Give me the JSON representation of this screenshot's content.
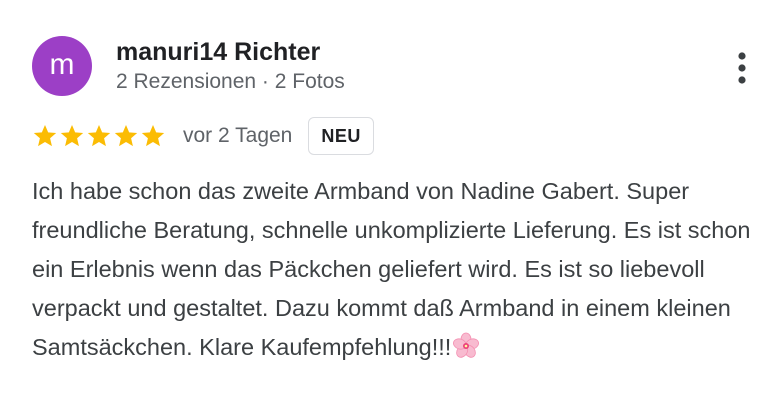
{
  "author": {
    "initial": "m",
    "name": "manuri14 Richter",
    "meta": "2 Rezensionen · 2 Fotos"
  },
  "rating": {
    "stars": 5,
    "max_stars": 5,
    "star_color": "#fbbc04",
    "date": "vor 2 Tagen",
    "badge": "NEU"
  },
  "review": {
    "text": "Ich habe schon das zweite Armband von Nadine Gabert. Super freundliche Beratung, schnelle unkomplizierte Lieferung. Es ist schon ein Erlebnis wenn das Päckchen geliefert wird. Es ist so liebevoll verpackt und gestaltet. Dazu kommt daß Armband in einem kleinen Samtsäckchen. Klare Kaufempfehlung!!!",
    "trailing_icon": "cherry-blossom-icon"
  },
  "colors": {
    "avatar_bg": "#9c3fc6",
    "name_text": "#202124",
    "meta_text": "#5f6368",
    "body_text": "#3c4043"
  },
  "icons": {
    "more": "more-vert-icon",
    "star": "star-icon"
  }
}
